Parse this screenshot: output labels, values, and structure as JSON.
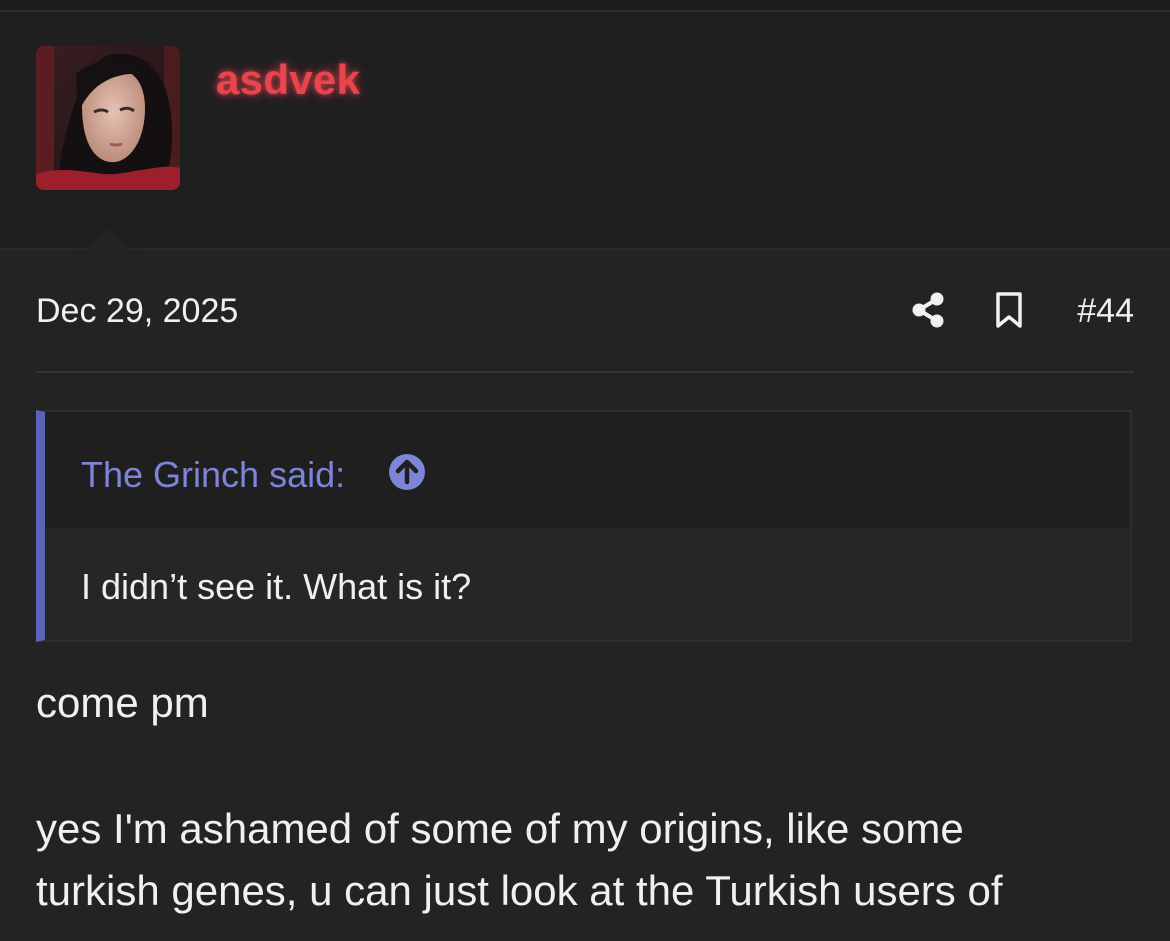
{
  "user": {
    "username": "asdvek",
    "username_color": "#e8454f"
  },
  "post": {
    "date": "Dec 29, 2025",
    "number": "#44",
    "icons": [
      "share-icon",
      "bookmark-icon"
    ]
  },
  "quote": {
    "attribution": "The Grinch said:",
    "body": "I didn’t see it. What is it?",
    "accent_color": "#5b63b7",
    "icon": "arrow-up-circle-icon"
  },
  "content": {
    "line1": "come pm",
    "line2": "yes I'm ashamed of some of my origins, like some",
    "line3": "turkish genes, u can just look at the Turkish users of"
  }
}
